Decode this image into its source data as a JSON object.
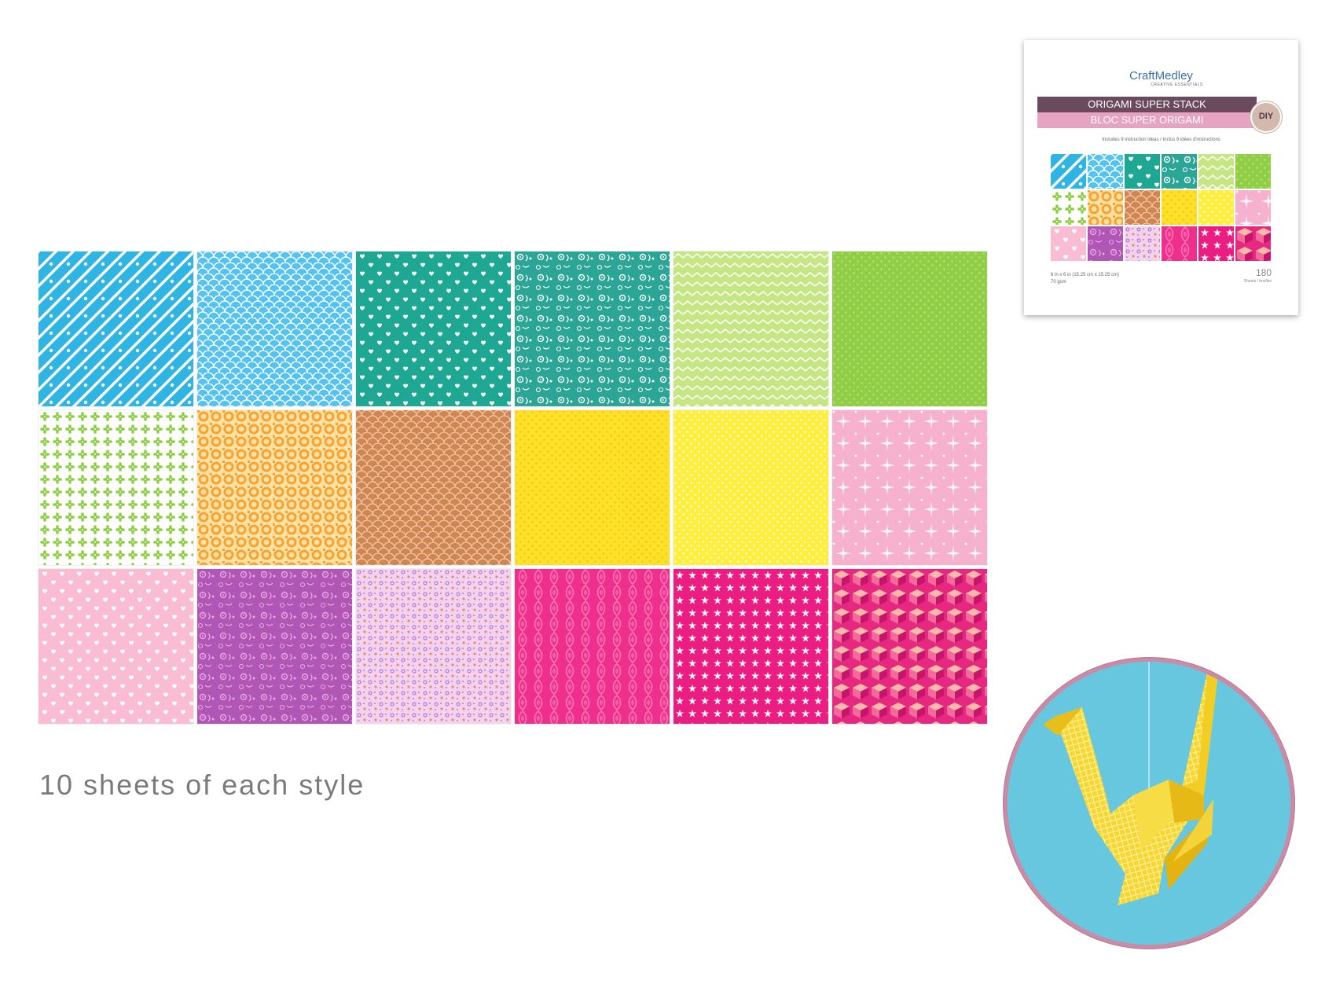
{
  "caption": "10 sheets of each style",
  "swatches": [
    {
      "pattern": "diagonal-stripes-dots",
      "colors": [
        "#2fb5e3",
        "#ffffff"
      ]
    },
    {
      "pattern": "scales",
      "colors": [
        "#55c3ef",
        "#ffffff"
      ]
    },
    {
      "pattern": "hearts",
      "colors": [
        "#1ea894",
        "#ffffff"
      ]
    },
    {
      "pattern": "floral",
      "colors": [
        "#2aa596",
        "#ffffff"
      ]
    },
    {
      "pattern": "chevron",
      "colors": [
        "#c6e583",
        "#ffffff"
      ]
    },
    {
      "pattern": "dots",
      "colors": [
        "#90ce45",
        "#bde184"
      ]
    },
    {
      "pattern": "grid-flowers",
      "colors": [
        "#ffffff",
        "#8ccf3e"
      ]
    },
    {
      "pattern": "quatrefoil",
      "colors": [
        "#f7a231",
        "#fde2a3"
      ]
    },
    {
      "pattern": "scales",
      "colors": [
        "#cf8652",
        "#f0c39e"
      ]
    },
    {
      "pattern": "dots",
      "colors": [
        "#fde02a",
        "#f4c400"
      ]
    },
    {
      "pattern": "dots",
      "colors": [
        "#ffee3c",
        "#ffffff"
      ]
    },
    {
      "pattern": "starburst",
      "colors": [
        "#f5b1cd",
        "#ffffff"
      ]
    },
    {
      "pattern": "hearts",
      "colors": [
        "#f9bcd2",
        "#ffffff"
      ]
    },
    {
      "pattern": "floral",
      "colors": [
        "#b057b6",
        "#e9a7e4"
      ]
    },
    {
      "pattern": "ditsy",
      "colors": [
        "#f2d3ef",
        "#b65ec0"
      ]
    },
    {
      "pattern": "ogee",
      "colors": [
        "#ee2f8b",
        "#ff79b9"
      ]
    },
    {
      "pattern": "stars",
      "colors": [
        "#ec1d82",
        "#ffffff"
      ]
    },
    {
      "pattern": "cubes",
      "colors": [
        "#e62881",
        "#fbb9a9"
      ]
    }
  ],
  "package": {
    "brand": "CraftMedley",
    "brand_sub": "CREATIVE ESSENTIALS",
    "title_en": "ORIGAMI SUPER STACK",
    "title_fr": "BLOC SUPER ORIGAMI",
    "badge": "DIY",
    "includes": "Includes 9 instruction ideas / Inclus 9 idées d'instructions",
    "size_line1": "6 in x 6 in (15.25 cm x 15.25 cm)",
    "size_line2": "70 gsm",
    "count": "180",
    "count_unit": "Sheets / feuilles"
  },
  "crane_image": {
    "background": "#66c7de",
    "crane_color": "#f7d631",
    "ring_color": "#c98ba6"
  }
}
